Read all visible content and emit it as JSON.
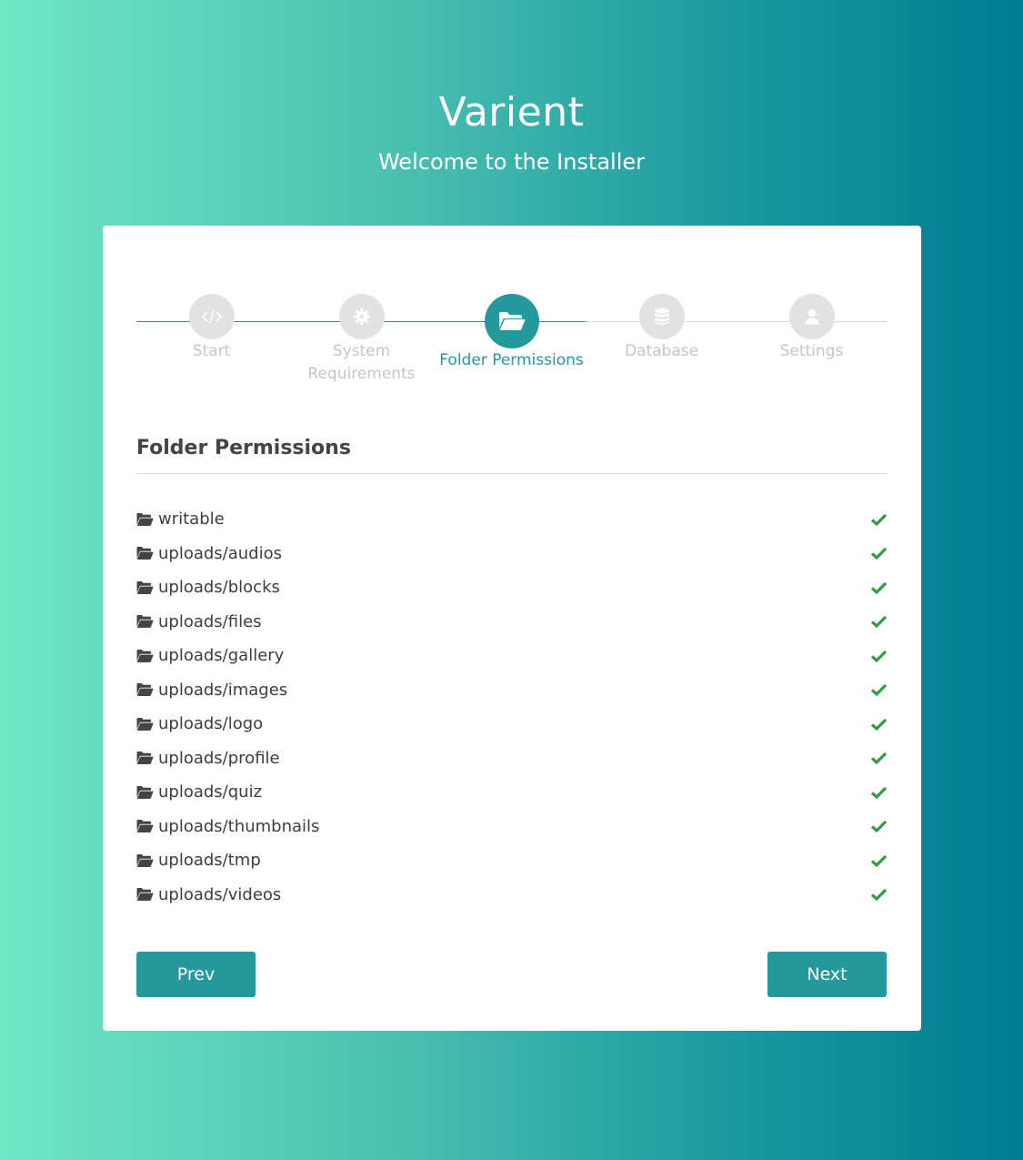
{
  "header": {
    "title": "Varient",
    "subtitle": "Welcome to the Installer"
  },
  "stepper": {
    "steps": [
      {
        "label": "Start",
        "icon": "code-icon",
        "state": "done"
      },
      {
        "label": "System Requirements",
        "icon": "gear-icon",
        "state": "done"
      },
      {
        "label": "Folder Permissions",
        "icon": "folder-open-icon",
        "state": "active"
      },
      {
        "label": "Database",
        "icon": "database-icon",
        "state": "todo"
      },
      {
        "label": "Settings",
        "icon": "user-icon",
        "state": "todo"
      }
    ]
  },
  "section": {
    "title": "Folder Permissions"
  },
  "folders": [
    {
      "name": "writable",
      "status": "ok"
    },
    {
      "name": "uploads/audios",
      "status": "ok"
    },
    {
      "name": "uploads/blocks",
      "status": "ok"
    },
    {
      "name": "uploads/files",
      "status": "ok"
    },
    {
      "name": "uploads/gallery",
      "status": "ok"
    },
    {
      "name": "uploads/images",
      "status": "ok"
    },
    {
      "name": "uploads/logo",
      "status": "ok"
    },
    {
      "name": "uploads/profile",
      "status": "ok"
    },
    {
      "name": "uploads/quiz",
      "status": "ok"
    },
    {
      "name": "uploads/thumbnails",
      "status": "ok"
    },
    {
      "name": "uploads/tmp",
      "status": "ok"
    },
    {
      "name": "uploads/videos",
      "status": "ok"
    }
  ],
  "buttons": {
    "prev_label": "Prev",
    "next_label": "Next"
  },
  "colors": {
    "accent": "#23999b",
    "check": "#2e9e3e",
    "inactive": "#e2e2e2"
  }
}
